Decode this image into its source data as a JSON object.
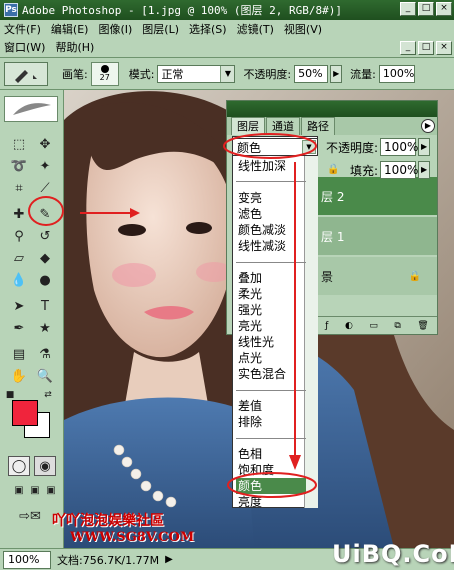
{
  "window": {
    "title": "Adobe Photoshop - [1.jpg @ 100% (图层 2, RGB/8#)]",
    "app_icon": "Ps",
    "minimize": "_",
    "maximize": "□",
    "close": "×"
  },
  "menubar": {
    "row1": [
      "文件(F)",
      "编辑(E)",
      "图像(I)",
      "图层(L)",
      "选择(S)",
      "滤镜(T)",
      "视图(V)"
    ],
    "row2": [
      "窗口(W)",
      "帮助(H)"
    ]
  },
  "options": {
    "brush_label": "画笔:",
    "brush_size": "27",
    "mode_label": "模式:",
    "mode_value": "正常",
    "opacity_label": "不透明度:",
    "opacity_value": "50%",
    "flow_label": "流量:",
    "flow_value": "100%"
  },
  "layers_panel": {
    "tabs": [
      "图层",
      "通道",
      "路径"
    ],
    "blend_mode": "颜色",
    "opacity_label": "不透明度:",
    "opacity_value": "100%",
    "fill_label": "填充:",
    "fill_value": "100%",
    "layers": [
      {
        "name": "层 2",
        "selected": true
      },
      {
        "name": "层 1",
        "selected": false
      },
      {
        "name": "景",
        "selected": false
      }
    ]
  },
  "blend_menu": {
    "items": [
      {
        "label": "线性加深",
        "group": 1
      },
      {
        "label": "变亮",
        "group": 2
      },
      {
        "label": "滤色",
        "group": 2
      },
      {
        "label": "颜色减淡",
        "group": 2
      },
      {
        "label": "线性减淡",
        "group": 2
      },
      {
        "label": "叠加",
        "group": 3
      },
      {
        "label": "柔光",
        "group": 3
      },
      {
        "label": "强光",
        "group": 3
      },
      {
        "label": "亮光",
        "group": 3
      },
      {
        "label": "线性光",
        "group": 3
      },
      {
        "label": "点光",
        "group": 3
      },
      {
        "label": "实色混合",
        "group": 3
      },
      {
        "label": "差值",
        "group": 4
      },
      {
        "label": "排除",
        "group": 4
      },
      {
        "label": "色相",
        "group": 5
      },
      {
        "label": "饱和度",
        "group": 5
      },
      {
        "label": "颜色",
        "group": 5,
        "highlighted": true
      },
      {
        "label": "亮度",
        "group": 5
      }
    ]
  },
  "status": {
    "zoom": "100%",
    "doc_info": "文档:756.7K/1.77M"
  },
  "watermarks": {
    "forum": "吖吖泡泡娱樂社區",
    "url": "WWW.SG8V.COM",
    "site": "UiBQ.CoM"
  },
  "colors": {
    "foreground": "#f0243c",
    "background": "#ffffff",
    "annotation": "#e02020"
  }
}
